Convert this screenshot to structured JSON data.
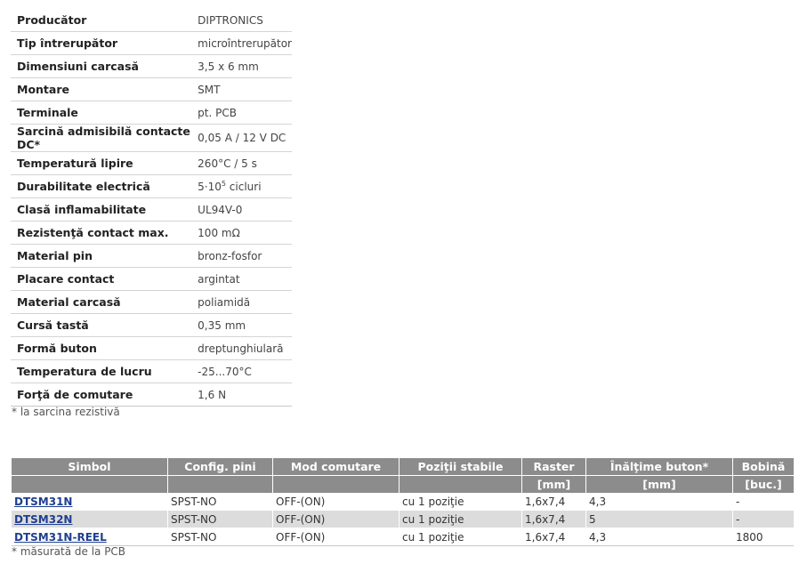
{
  "specs": [
    {
      "label": "Producător",
      "value": "DIPTRONICS"
    },
    {
      "label": "Tip întrerupător",
      "value": "microîntrerupător"
    },
    {
      "label": "Dimensiuni carcasă",
      "value": "3,5 x 6 mm"
    },
    {
      "label": "Montare",
      "value": "SMT"
    },
    {
      "label": "Terminale",
      "value": "pt. PCB"
    },
    {
      "label": "Sarcină admisibilă contacte DC*",
      "value": "0,05 A / 12 V DC"
    },
    {
      "label": "Temperatură lipire",
      "value": "260°C / 5 s"
    },
    {
      "label": "Durabilitate electrică",
      "value_base": "5·10",
      "value_exp": "5",
      "value_rest": " cicluri"
    },
    {
      "label": "Clasă inflamabilitate",
      "value": "UL94V-0"
    },
    {
      "label": "Rezistenţă contact max.",
      "value": "100 mΩ"
    },
    {
      "label": "Material pin",
      "value": "bronz-fosfor"
    },
    {
      "label": "Placare contact",
      "value": "argintat"
    },
    {
      "label": "Material carcasă",
      "value": "poliamidă"
    },
    {
      "label": "Cursă tastă",
      "value": "0,35 mm"
    },
    {
      "label": "Formă buton",
      "value": "dreptunghiulară"
    },
    {
      "label": "Temperatura de lucru",
      "value": "-25...70°C"
    },
    {
      "label": "Forţă de comutare",
      "value": "1,6 N"
    }
  ],
  "spec_note": "* la sarcina rezistivă",
  "products": {
    "headers": [
      "Simbol",
      "Config. pini",
      "Mod comutare",
      "Poziţii stabile",
      "Raster",
      "Înălţime buton*",
      "Bobină"
    ],
    "subheaders": [
      "",
      "",
      "",
      "",
      "[mm]",
      "[mm]",
      "[buc.]"
    ],
    "rows": [
      [
        "DTSM31N",
        "SPST-NO",
        "OFF-(ON)",
        "cu 1 poziţie",
        "1,6x7,4",
        "4,3",
        "-"
      ],
      [
        "DTSM32N",
        "SPST-NO",
        "OFF-(ON)",
        "cu 1 poziţie",
        "1,6x7,4",
        "5",
        "-"
      ],
      [
        "DTSM31N-REEL",
        "SPST-NO",
        "OFF-(ON)",
        "cu 1 poziţie",
        "1,6x7,4",
        "4,3",
        "1800"
      ]
    ],
    "colors": {
      "header_bg": "#8c8c8c",
      "alt_row_bg": "#dcdcdc",
      "link": "#1f3f8f"
    }
  },
  "products_note": "* măsurată de la PCB"
}
